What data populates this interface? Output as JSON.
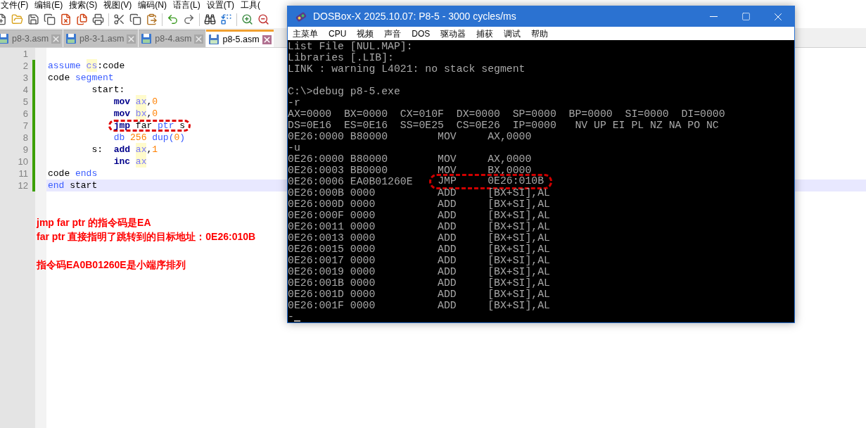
{
  "menu": [
    "文件(F)",
    "编辑(E)",
    "搜索(S)",
    "视图(V)",
    "编码(N)",
    "语言(L)",
    "设置(T)",
    "工具("
  ],
  "tabs": [
    {
      "label": "p8-3.asm",
      "selected": false
    },
    {
      "label": "p8-3-1.asm",
      "selected": false
    },
    {
      "label": "p8-4.asm",
      "selected": false
    },
    {
      "label": "p8-5.asm",
      "selected": true
    }
  ],
  "editor": {
    "lines": [
      {
        "number": "1",
        "changed": false,
        "current": false
      },
      {
        "number": "2",
        "changed": true,
        "current": false,
        "tokens": [
          {
            "text": "assume ",
            "kind": "directive"
          },
          {
            "text": "cs",
            "kind": "register"
          },
          {
            "text": ":code",
            "kind": "plain"
          }
        ]
      },
      {
        "number": "3",
        "changed": true,
        "current": false,
        "tokens": [
          {
            "text": "code ",
            "kind": "plain"
          },
          {
            "text": "segment",
            "kind": "directive"
          }
        ]
      },
      {
        "number": "4",
        "changed": true,
        "current": false,
        "tokens": [
          {
            "text": "        start:",
            "kind": "plain"
          }
        ]
      },
      {
        "number": "5",
        "changed": true,
        "current": false,
        "tokens": [
          {
            "text": "            mov ",
            "kind": "instruction"
          },
          {
            "text": "ax",
            "kind": "register"
          },
          {
            "text": ",",
            "kind": "plain"
          },
          {
            "text": "0",
            "kind": "number"
          }
        ]
      },
      {
        "number": "6",
        "changed": true,
        "current": false,
        "tokens": [
          {
            "text": "            mov ",
            "kind": "instruction"
          },
          {
            "text": "bx",
            "kind": "register"
          },
          {
            "text": ",",
            "kind": "plain"
          },
          {
            "text": "0",
            "kind": "number"
          }
        ]
      },
      {
        "number": "7",
        "changed": true,
        "current": false,
        "annotated": true,
        "tokens": [
          {
            "text": "            jmp ",
            "kind": "instruction"
          },
          {
            "text": "far ",
            "kind": "plain"
          },
          {
            "text": "ptr ",
            "kind": "directive"
          },
          {
            "text": "s",
            "kind": "plain"
          }
        ]
      },
      {
        "number": "8",
        "changed": true,
        "current": false,
        "tokens": [
          {
            "text": "            db ",
            "kind": "directive"
          },
          {
            "text": "256 ",
            "kind": "number"
          },
          {
            "text": "dup(",
            "kind": "directive"
          },
          {
            "text": "0",
            "kind": "number"
          },
          {
            "text": ")",
            "kind": "directive"
          }
        ]
      },
      {
        "number": "9",
        "changed": true,
        "current": false,
        "tokens": [
          {
            "text": "        s:  ",
            "kind": "plain"
          },
          {
            "text": "add ",
            "kind": "instruction"
          },
          {
            "text": "ax",
            "kind": "register"
          },
          {
            "text": ",",
            "kind": "plain"
          },
          {
            "text": "1",
            "kind": "number"
          }
        ]
      },
      {
        "number": "10",
        "changed": true,
        "current": false,
        "tokens": [
          {
            "text": "            inc ",
            "kind": "instruction"
          },
          {
            "text": "ax",
            "kind": "register"
          }
        ]
      },
      {
        "number": "11",
        "changed": true,
        "current": false,
        "tokens": [
          {
            "text": "code ",
            "kind": "plain"
          },
          {
            "text": "ends",
            "kind": "directive"
          }
        ]
      },
      {
        "number": "12",
        "changed": true,
        "current": true,
        "tokens": [
          {
            "text": "end ",
            "kind": "directive"
          },
          {
            "text": "start",
            "kind": "plain"
          }
        ]
      }
    ],
    "notes": [
      "jmp far ptr 的指令码是EA",
      "far ptr 直接指明了跳转到的目标地址：0E26:010B",
      "指令码EA0B01260E是小端序排列"
    ]
  },
  "dosbox": {
    "title": "DOSBox-X 2025.10.07: P8-5 - 3000 cycles/ms",
    "menu": [
      "主菜单",
      "CPU",
      "视频",
      "声音",
      "DOS",
      "驱动器",
      "捕获",
      "调试",
      "帮助"
    ],
    "lines": [
      {
        "kind": "text",
        "text": "List File [NUL.MAP]:"
      },
      {
        "kind": "text",
        "text": "Libraries [.LIB]:"
      },
      {
        "kind": "text",
        "text": "LINK : warning L4021: no stack segment"
      },
      {
        "kind": "blank"
      },
      {
        "kind": "text",
        "text": "C:\\>debug p8-5.exe"
      },
      {
        "kind": "text",
        "text": "-r"
      },
      {
        "kind": "text",
        "text": "AX=0000  BX=0000  CX=010F  DX=0000  SP=0000  BP=0000  SI=0000  DI=0000"
      },
      {
        "kind": "text",
        "text": "DS=0E16  ES=0E16  SS=0E25  CS=0E26  IP=0000   NV UP EI PL NZ NA PO NC"
      },
      {
        "kind": "text",
        "text": "0E26:0000 B80000        MOV     AX,0000"
      },
      {
        "kind": "text",
        "text": "-u"
      },
      {
        "kind": "text",
        "text": "0E26:0000 B80000        MOV     AX,0000"
      },
      {
        "kind": "text",
        "text": "0E26:0003 BB0000        MOV     BX,0000"
      },
      {
        "kind": "text",
        "text": "0E26:0006 EA0B01260E    ",
        "annotated": "JMP     0E26:010B"
      },
      {
        "kind": "text",
        "text": "0E26:000B 0000          ADD     [BX+SI],AL"
      },
      {
        "kind": "text",
        "text": "0E26:000D 0000          ADD     [BX+SI],AL"
      },
      {
        "kind": "text",
        "text": "0E26:000F 0000          ADD     [BX+SI],AL"
      },
      {
        "kind": "text",
        "text": "0E26:0011 0000          ADD     [BX+SI],AL"
      },
      {
        "kind": "text",
        "text": "0E26:0013 0000          ADD     [BX+SI],AL"
      },
      {
        "kind": "text",
        "text": "0E26:0015 0000          ADD     [BX+SI],AL"
      },
      {
        "kind": "text",
        "text": "0E26:0017 0000          ADD     [BX+SI],AL"
      },
      {
        "kind": "text",
        "text": "0E26:0019 0000          ADD     [BX+SI],AL"
      },
      {
        "kind": "text",
        "text": "0E26:001B 0000          ADD     [BX+SI],AL"
      },
      {
        "kind": "text",
        "text": "0E26:001D 0000          ADD     [BX+SI],AL"
      },
      {
        "kind": "text",
        "text": "0E26:001F 0000          ADD     [BX+SI],AL"
      },
      {
        "kind": "text",
        "text": "-",
        "cursor": true
      }
    ]
  }
}
